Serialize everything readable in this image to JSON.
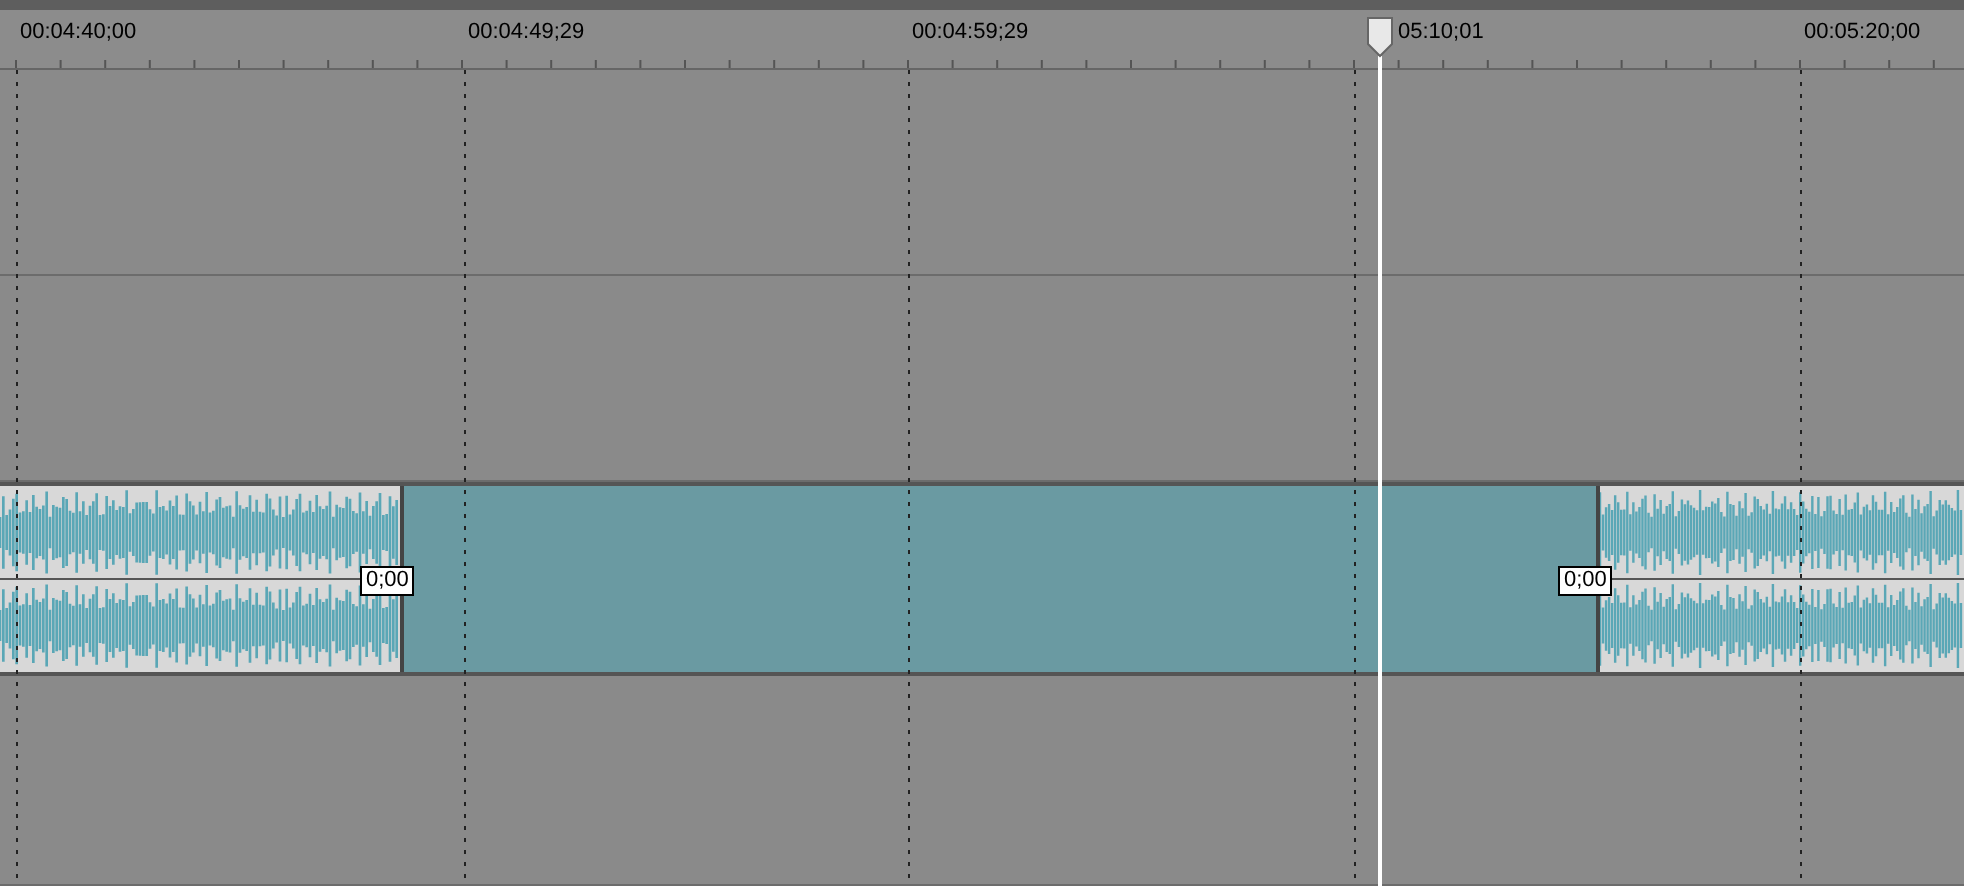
{
  "ruler": {
    "labels": [
      "00:04:40;00",
      "00:04:49;29",
      "00:04:59;29",
      "00:05:20;00"
    ],
    "playhead_label": "05:10;01"
  },
  "tracks": [
    {
      "kind": "empty"
    },
    {
      "kind": "empty"
    },
    {
      "kind": "audio",
      "clips": [
        {
          "kind": "audio",
          "fade_label": "0;00"
        },
        {
          "kind": "gap"
        },
        {
          "kind": "audio",
          "fade_label": "0;00"
        }
      ]
    },
    {
      "kind": "empty"
    }
  ]
}
